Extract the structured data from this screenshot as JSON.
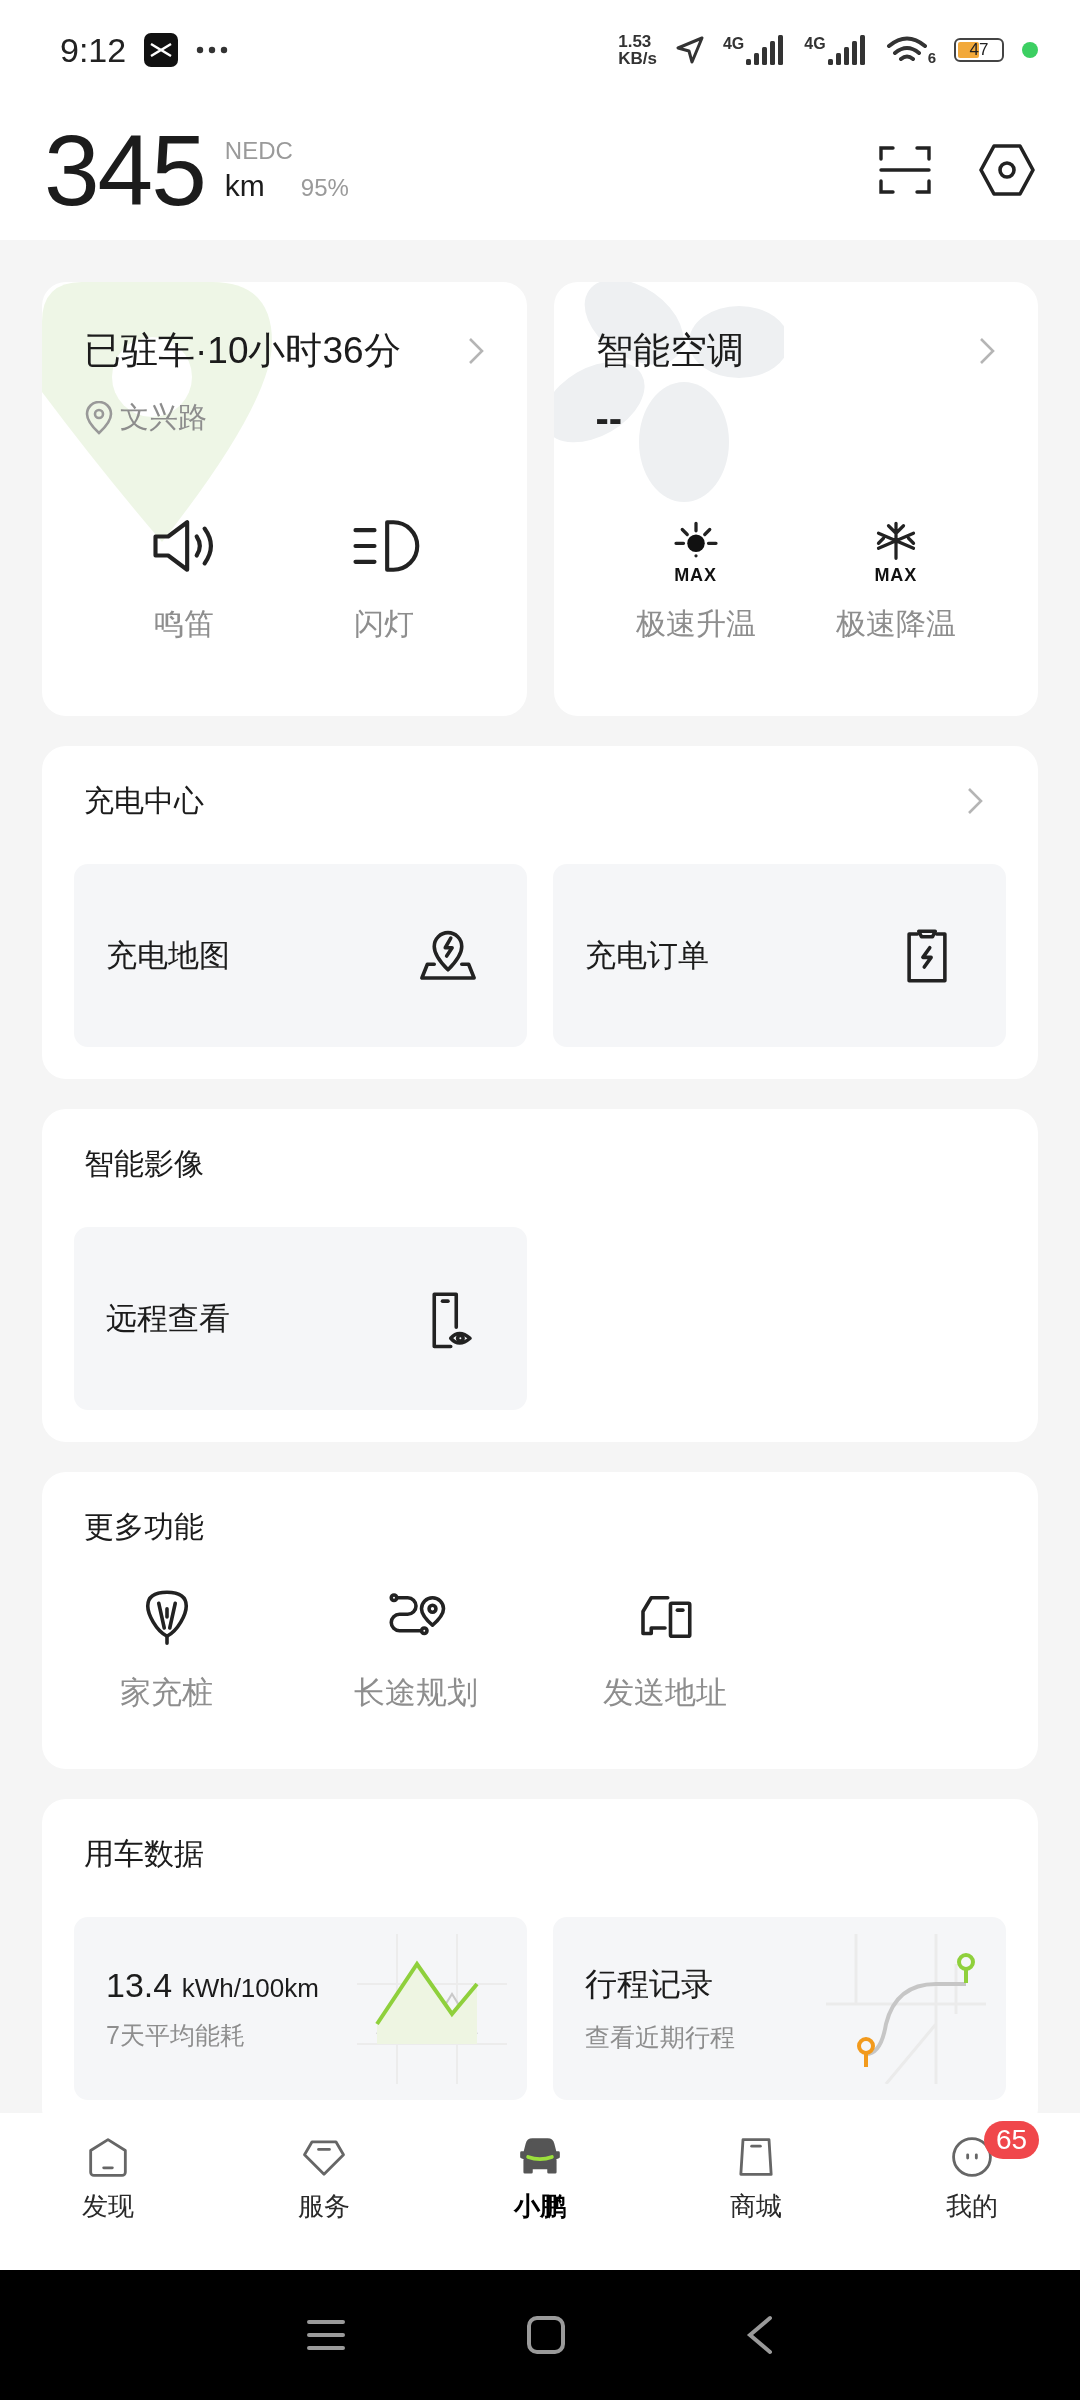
{
  "status_bar": {
    "time": "9:12",
    "net_speed": [
      "1.53",
      "KB/s"
    ],
    "signals": [
      {
        "label": "4G"
      },
      {
        "label": "4G"
      }
    ],
    "wifi_label": "6",
    "battery": "47"
  },
  "header": {
    "range": "345",
    "standard": "NEDC",
    "unit": "km",
    "battery_percent": "95%"
  },
  "parking": {
    "title": "已驻车·10小时36分",
    "location": "文兴路",
    "actions": [
      {
        "kind": "horn",
        "label": "鸣笛"
      },
      {
        "kind": "lights",
        "label": "闪灯"
      }
    ]
  },
  "climate": {
    "title": "智能空调",
    "value": "--",
    "actions": [
      {
        "kind": "heat",
        "badge": "MAX",
        "label": "极速升温"
      },
      {
        "kind": "cool",
        "badge": "MAX",
        "label": "极速降温"
      }
    ]
  },
  "sections": [
    {
      "title": "充电中心",
      "has_arrow": true,
      "tiles": [
        {
          "kind": "charge-map",
          "label": "充电地图"
        },
        {
          "kind": "charge-order",
          "label": "充电订单"
        }
      ]
    },
    {
      "title": "智能影像",
      "has_arrow": false,
      "tiles": [
        {
          "kind": "remote-view",
          "label": "远程查看"
        }
      ]
    }
  ],
  "more": {
    "title": "更多功能",
    "items": [
      {
        "kind": "home-charger",
        "label": "家充桩"
      },
      {
        "kind": "route",
        "label": "长途规划"
      },
      {
        "kind": "send-address",
        "label": "发送地址"
      }
    ]
  },
  "vehicle_data": {
    "title": "用车数据",
    "energy": {
      "value": "13.4",
      "unit": "kWh/100km",
      "caption": "7天平均能耗"
    },
    "trips": {
      "title": "行程记录",
      "caption": "查看近期行程"
    }
  },
  "tabs": [
    {
      "kind": "discover",
      "label": "发现",
      "selected": false
    },
    {
      "kind": "service",
      "label": "服务",
      "selected": false
    },
    {
      "kind": "car",
      "label": "小鹏",
      "selected": true
    },
    {
      "kind": "mall",
      "label": "商城",
      "selected": false
    },
    {
      "kind": "me",
      "label": "我的",
      "selected": false,
      "badge": "65"
    }
  ]
}
